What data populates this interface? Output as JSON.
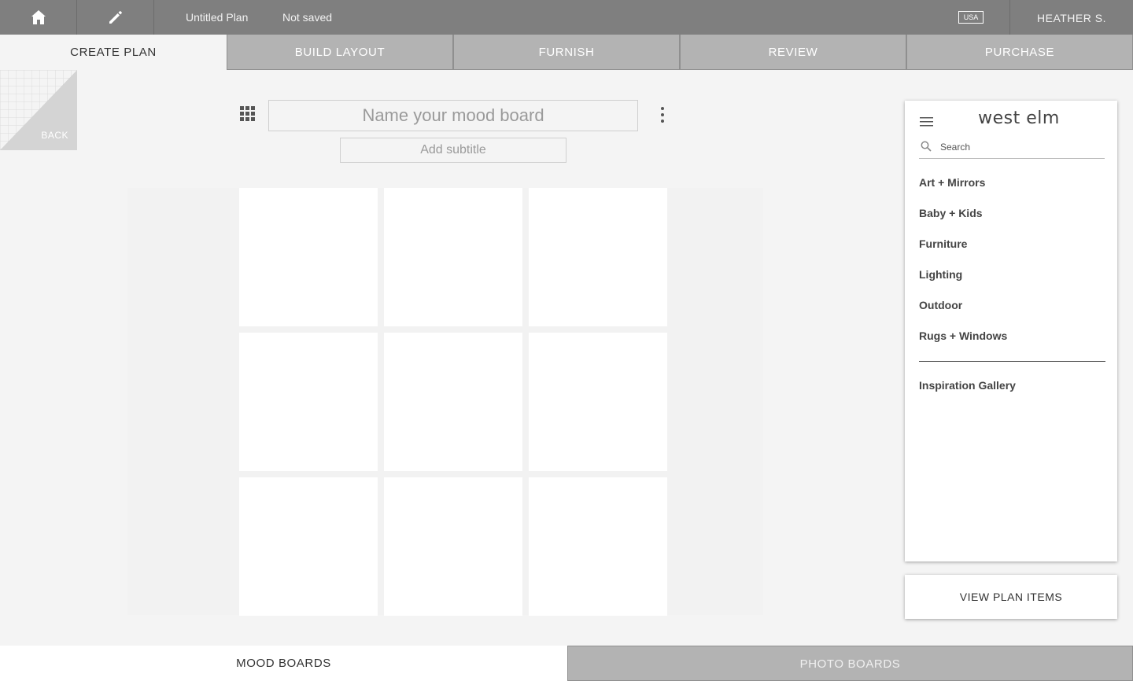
{
  "topbar": {
    "home_icon": "home-icon",
    "edit_icon": "pencil-icon",
    "plan_title": "Untitled Plan",
    "save_status": "Not saved",
    "region": "USA",
    "user": "HEATHER S."
  },
  "steps": [
    {
      "label": "CREATE PLAN",
      "active": true
    },
    {
      "label": "BUILD LAYOUT",
      "active": false
    },
    {
      "label": "FURNISH",
      "active": false
    },
    {
      "label": "REVIEW",
      "active": false
    },
    {
      "label": "PURCHASE",
      "active": false
    }
  ],
  "back": {
    "label": "BACK"
  },
  "board": {
    "name_placeholder": "Name your mood board",
    "subtitle_placeholder": "Add subtitle",
    "tile_count": 9
  },
  "catalog": {
    "brand": "west elm",
    "search_placeholder": "Search",
    "categories": [
      "Art + Mirrors",
      "Baby + Kids",
      "Furniture",
      "Lighting",
      "Outdoor",
      "Rugs + Windows"
    ],
    "extra_link": "Inspiration Gallery"
  },
  "view_plan_items": "VIEW PLAN ITEMS",
  "bottom_tabs": [
    {
      "label": "MOOD BOARDS",
      "active": true
    },
    {
      "label": "PHOTO BOARDS",
      "active": false
    }
  ],
  "colors": {
    "topbar": "#7f7f7f",
    "inactive_tab": "#b3b3b3",
    "page": "#f4f4f4"
  }
}
